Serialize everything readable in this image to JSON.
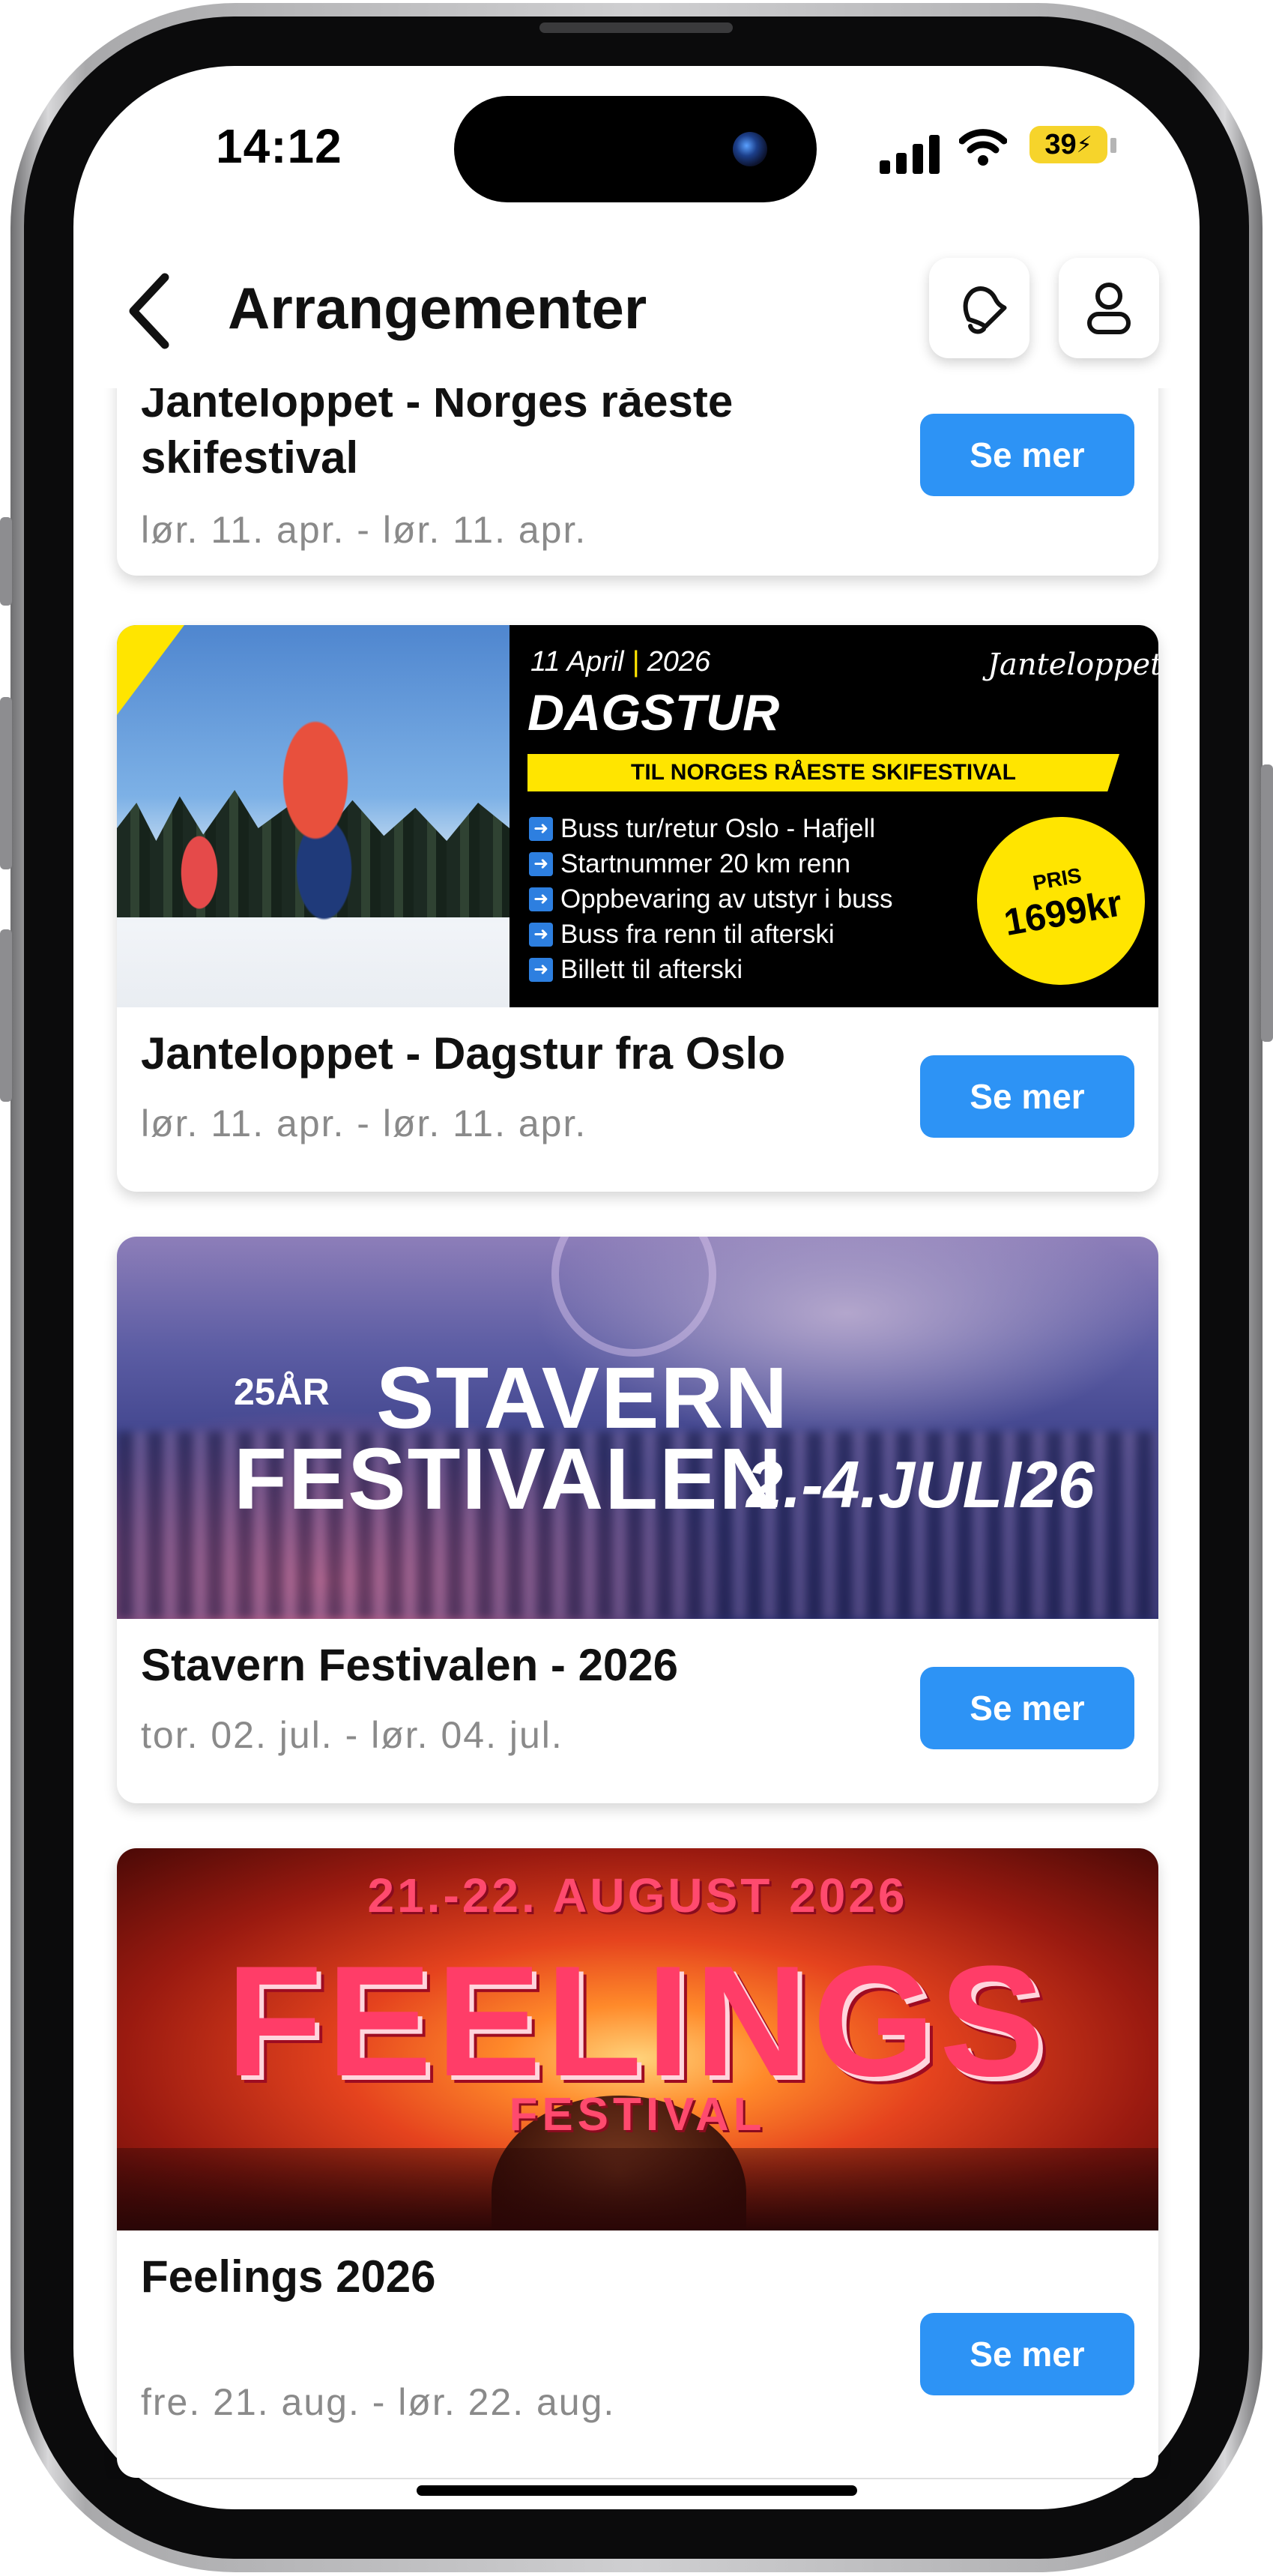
{
  "status_bar": {
    "time": "14:12",
    "battery": "39"
  },
  "header": {
    "title": "Arrangementer",
    "back_icon": "chevron-left-icon",
    "notifications_icon": "bell-icon",
    "profile_icon": "user-icon"
  },
  "accent_color": "#2d93f5",
  "events": [
    {
      "title": "Janteloppet - Norges råeste skifestival",
      "date": "lør. 11. apr. - lør. 11. apr.",
      "button": "Se mer"
    },
    {
      "title": "Janteloppet - Dagstur fra Oslo",
      "date": "lør. 11. apr. - lør. 11. apr.",
      "button": "Se mer",
      "banner": {
        "date_day": "11 April",
        "date_sep": "|",
        "date_year": "2026",
        "headline": "DAGSTUR",
        "strip": "TIL NORGES RÅESTE SKIFESTIVAL",
        "logo": "Janteloppet",
        "bullets": [
          "Buss tur/retur Oslo - Hafjell",
          "Startnummer 20 km renn",
          "Oppbevaring av utstyr i buss",
          "Buss fra renn til afterski",
          "Billett til afterski"
        ],
        "price_label": "PRIS",
        "price": "1699kr"
      }
    },
    {
      "title": "Stavern Festivalen - 2026",
      "date": "tor. 02. jul. - lør. 04. jul.",
      "button": "Se mer",
      "banner": {
        "anniversary": "25ÅR",
        "line1": "STAVERN",
        "line2": "FESTIVALEN",
        "dates": "2.-4.JULI26"
      }
    },
    {
      "title": "Feelings 2026",
      "date": "fre. 21. aug. - lør. 22. aug.",
      "button": "Se mer",
      "banner": {
        "top": "21.-22. AUGUST 2026",
        "main": "FEELINGS",
        "sub": "FESTIVAL"
      }
    }
  ]
}
